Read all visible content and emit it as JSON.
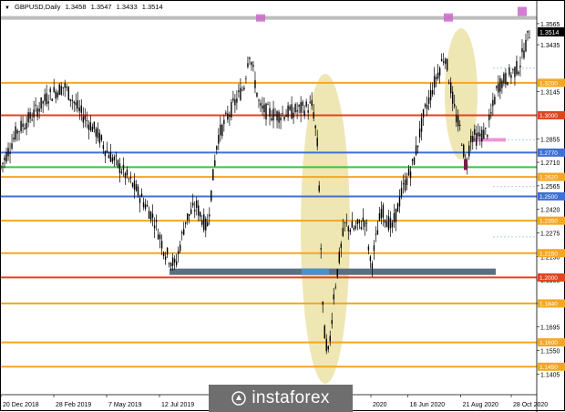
{
  "header": {
    "symbol": "GBPUSD,Daily",
    "open": "1.3458",
    "high": "1.3547",
    "low": "1.3433",
    "close": "1.3514"
  },
  "watermark": {
    "text": "instaforex"
  },
  "chart_data": {
    "type": "candlestick",
    "symbol": "GBPUSD",
    "timeframe": "Daily",
    "ylim": [
      1.13,
      1.366
    ],
    "price_ticks": [
      "1.3565",
      "1.3435",
      "1.3145",
      "1.2855",
      "1.2710",
      "1.2565",
      "1.2420",
      "1.2275",
      "1.2130",
      "1.1985",
      "1.1840",
      "1.1695",
      "1.1550",
      "1.1405"
    ],
    "current_price": "1.3514",
    "x_ticks": [
      {
        "label": "20 Dec 2018",
        "pos": 0.0
      },
      {
        "label": "28 Feb 2019",
        "pos": 0.1
      },
      {
        "label": "7 May 2019",
        "pos": 0.2
      },
      {
        "label": "12 Jul 2019",
        "pos": 0.3
      },
      {
        "label": "18",
        "pos": 0.4
      },
      {
        "label": "2020",
        "pos": 0.7
      },
      {
        "label": "16 Jun 2020",
        "pos": 0.77
      },
      {
        "label": "21 Aug 2020",
        "pos": 0.87
      },
      {
        "label": "28 Oct 2020",
        "pos": 0.97
      }
    ],
    "levels": [
      {
        "price": 1.36,
        "color": "#bdbdbd",
        "label": ""
      },
      {
        "price": 1.32,
        "color": "#f5a623",
        "label": "1.3200"
      },
      {
        "price": 1.3,
        "color": "#e0451f",
        "label": "1.3000"
      },
      {
        "price": 1.277,
        "color": "#3f6fd8",
        "label": "1.2770"
      },
      {
        "price": 1.268,
        "color": "#3cc43c",
        "label": ""
      },
      {
        "price": 1.262,
        "color": "#f5a623",
        "label": "1.2620"
      },
      {
        "price": 1.25,
        "color": "#3f6fd8",
        "label": "1.2500"
      },
      {
        "price": 1.235,
        "color": "#f5a623",
        "label": "1.2350"
      },
      {
        "price": 1.215,
        "color": "#f5a623",
        "label": "1.2150"
      },
      {
        "price": 1.2,
        "color": "#e0451f",
        "label": "1.2000"
      },
      {
        "price": 1.184,
        "color": "#f5a623",
        "label": "1.1840"
      },
      {
        "price": 1.16,
        "color": "#f5a623",
        "label": "1.1600"
      },
      {
        "price": 1.145,
        "color": "#f5a623",
        "label": "1.1450"
      }
    ],
    "price_path": [
      [
        0,
        1.268
      ],
      [
        0.03,
        1.29
      ],
      [
        0.06,
        1.3
      ],
      [
        0.09,
        1.312
      ],
      [
        0.12,
        1.318
      ],
      [
        0.15,
        1.302
      ],
      [
        0.18,
        1.29
      ],
      [
        0.2,
        1.278
      ],
      [
        0.23,
        1.266
      ],
      [
        0.26,
        1.252
      ],
      [
        0.29,
        1.236
      ],
      [
        0.31,
        1.216
      ],
      [
        0.33,
        1.207
      ],
      [
        0.35,
        1.236
      ],
      [
        0.37,
        1.244
      ],
      [
        0.39,
        1.23
      ],
      [
        0.41,
        1.286
      ],
      [
        0.43,
        1.3
      ],
      [
        0.46,
        1.318
      ],
      [
        0.47,
        1.34
      ],
      [
        0.49,
        1.304
      ],
      [
        0.52,
        1.3
      ],
      [
        0.55,
        1.302
      ],
      [
        0.57,
        1.304
      ],
      [
        0.59,
        1.306
      ],
      [
        0.6,
        1.278
      ],
      [
        0.61,
        1.17
      ],
      [
        0.62,
        1.152
      ],
      [
        0.63,
        1.19
      ],
      [
        0.65,
        1.232
      ],
      [
        0.67,
        1.23
      ],
      [
        0.69,
        1.236
      ],
      [
        0.7,
        1.206
      ],
      [
        0.72,
        1.242
      ],
      [
        0.74,
        1.23
      ],
      [
        0.76,
        1.254
      ],
      [
        0.78,
        1.27
      ],
      [
        0.8,
        1.3
      ],
      [
        0.82,
        1.32
      ],
      [
        0.84,
        1.338
      ],
      [
        0.86,
        1.3
      ],
      [
        0.87,
        1.29
      ],
      [
        0.88,
        1.268
      ],
      [
        0.89,
        1.288
      ],
      [
        0.9,
        1.286
      ],
      [
        0.92,
        1.29
      ],
      [
        0.94,
        1.318
      ],
      [
        0.96,
        1.324
      ],
      [
        0.98,
        1.33
      ],
      [
        1.0,
        1.351
      ]
    ]
  }
}
